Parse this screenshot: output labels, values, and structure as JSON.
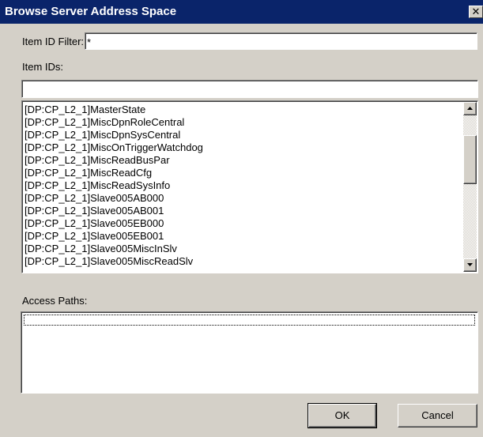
{
  "window": {
    "title": "Browse Server Address Space",
    "close_glyph": "✕"
  },
  "filter": {
    "label": "Item ID Filter:",
    "value": "*"
  },
  "item_ids": {
    "label": "Item IDs:",
    "input_value": "",
    "items": [
      "[DP:CP_L2_1]MasterState",
      "[DP:CP_L2_1]MiscDpnRoleCentral",
      "[DP:CP_L2_1]MiscDpnSysCentral",
      "[DP:CP_L2_1]MiscOnTriggerWatchdog",
      "[DP:CP_L2_1]MiscReadBusPar",
      "[DP:CP_L2_1]MiscReadCfg",
      "[DP:CP_L2_1]MiscReadSysInfo",
      "[DP:CP_L2_1]Slave005AB000",
      "[DP:CP_L2_1]Slave005AB001",
      "[DP:CP_L2_1]Slave005EB000",
      "[DP:CP_L2_1]Slave005EB001",
      "[DP:CP_L2_1]Slave005MiscInSlv",
      "[DP:CP_L2_1]Slave005MiscReadSlv"
    ]
  },
  "access_paths": {
    "label": "Access Paths:",
    "items": []
  },
  "buttons": {
    "ok": "OK",
    "cancel": "Cancel"
  }
}
